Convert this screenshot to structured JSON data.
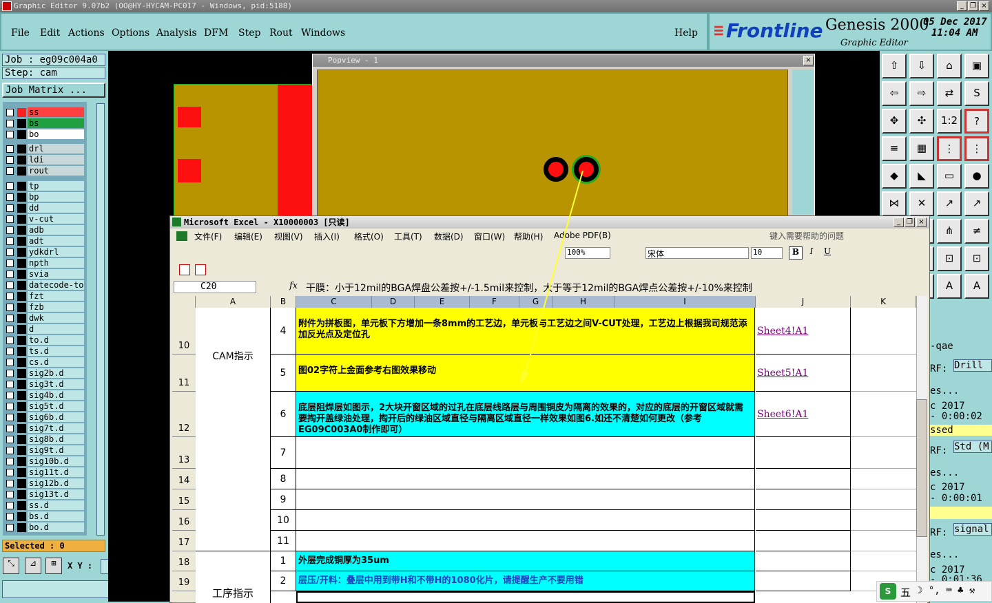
{
  "window": {
    "title": "Graphic Editor 9.07b2 (OO@HY-HYCAM-PC017 - Windows, pid:5188)"
  },
  "menu": [
    "File",
    "Edit",
    "Actions",
    "Options",
    "Analysis",
    "DFM",
    "Step",
    "Rout",
    "Windows"
  ],
  "help": "Help",
  "logo": {
    "brand": "Frontline",
    "product": "Genesis 2000",
    "subtitle": "Graphic Editor",
    "date": "05 Dec 2017",
    "time": "11:04 AM"
  },
  "job": {
    "job": "Job : eg09c004a0",
    "step": "Step: cam",
    "matrix": "Job Matrix ..."
  },
  "layers_top": [
    {
      "name": "ss",
      "color": "#ff4040"
    },
    {
      "name": "bs",
      "color": "#20a040"
    },
    {
      "name": "bo",
      "color": "#ffffff"
    }
  ],
  "layers_mid": [
    "drl",
    "ldi",
    "rout"
  ],
  "layers_list": [
    "tp",
    "bp",
    "dd",
    "v-cut",
    "adb",
    "adt",
    "ydkdrl",
    "npth",
    "svia",
    "datecode-to",
    "fzt",
    "fzb",
    "dwk",
    "d",
    "to.d",
    "ts.d",
    "cs.d",
    "sig2b.d",
    "sig3t.d",
    "sig4b.d",
    "sig5t.d",
    "sig6b.d",
    "sig7t.d",
    "sig8b.d",
    "sig9t.d",
    "sig10b.d",
    "sig11t.d",
    "sig12b.d",
    "sig13t.d",
    "ss.d",
    "bs.d",
    "bo.d"
  ],
  "selected": "Selected : 0",
  "xy": "X Y :",
  "popview": {
    "title": "Popview - 1"
  },
  "excel": {
    "title": "Microsoft Excel - X10000003  [只读]",
    "menu": [
      "文件(F)",
      "编辑(E)",
      "视图(V)",
      "插入(I)",
      "格式(O)",
      "工具(T)",
      "数据(D)",
      "窗口(W)",
      "帮助(H)",
      "Adobe PDF(B)"
    ],
    "help_placeholder": "键入需要帮助的问题",
    "zoom": "100%",
    "font": "宋体",
    "font_size": "10",
    "cell_ref": "C20",
    "formula": "干膜：小于12mil的BGA焊盘公差按+/-1.5mil来控制，大于等于12mil的BGA焊点公差按+/-10%来控制",
    "columns": [
      "A",
      "B",
      "C",
      "D",
      "E",
      "F",
      "G",
      "H",
      "I",
      "J",
      "K"
    ],
    "section_cam": "CAM指示",
    "section_process": "工序指示",
    "rows": [
      {
        "row": "10",
        "num": "4",
        "text": "附件为拼板图，单元板下方增加一条8mm的工艺边，单元板与工艺边之间V-CUT处理，工艺边上根据我司规范添加反光点及定位孔",
        "link": "Sheet4!A1"
      },
      {
        "row": "11",
        "num": "5",
        "text": "图02字符上金面参考右图效果移动",
        "link": "Sheet5!A1"
      },
      {
        "row": "12",
        "num": "6",
        "text": "底层阻焊层如图示，2大块开窗区域的过孔在底层线路层与周围铜皮为隔离的效果的，对应的底层的开窗区域就需要掏开盖绿油处理，掏开后的绿油区域直径与隔离区域直径一样效果如图6.如还不清楚如何更改（参考EG09C003A0制作即可）",
        "link": "Sheet6!A1"
      },
      {
        "row": "13",
        "num": "7",
        "text": "",
        "link": ""
      },
      {
        "row": "14",
        "num": "8",
        "text": "",
        "link": ""
      },
      {
        "row": "15",
        "num": "9",
        "text": "",
        "link": ""
      },
      {
        "row": "16",
        "num": "10",
        "text": "",
        "link": ""
      },
      {
        "row": "17",
        "num": "11",
        "text": "",
        "link": ""
      },
      {
        "row": "18",
        "num": "1",
        "text": "外层完成铜厚为35um",
        "link": ""
      },
      {
        "row": "19",
        "num": "2",
        "text": "层压/开料：叠层中用到带H和不带H的1080化片，请提醒生产不要用错",
        "link": ""
      }
    ]
  },
  "right_panel": {
    "qae": "-qae",
    "rf1": "RF:",
    "drill": "Drill",
    "es1": "es...",
    "date1": "c 2017",
    "time1": "- 0:00:02",
    "ssed": "ssed",
    "rf2": "RF:",
    "std": "Std (M",
    "es2": "es...",
    "date2": "c 2017",
    "time2": "- 0:00:01",
    "rf3": "RF:",
    "signal": "signal",
    "es3": "es...",
    "date3": "c 2017",
    "time3": "- 0:01:36"
  },
  "ime": "五"
}
